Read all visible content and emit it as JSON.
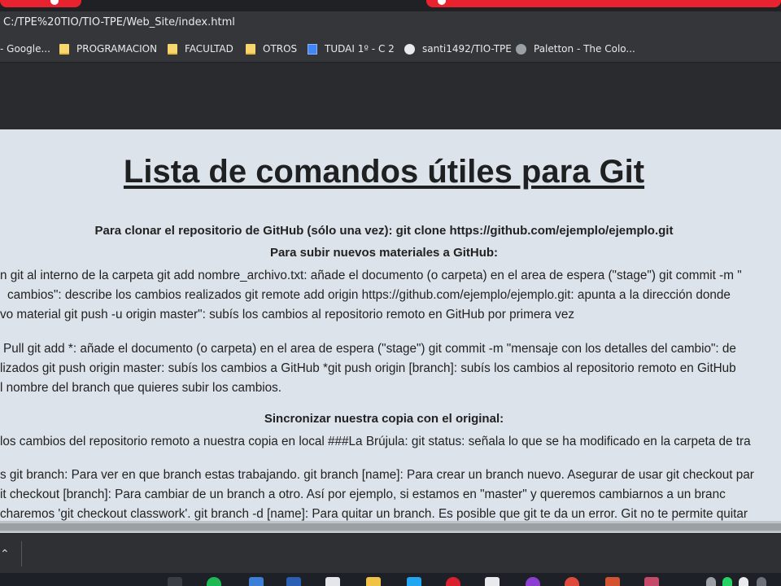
{
  "browser": {
    "url": "C:/TPE%20TIO/TIO-TPE/Web_Site/index.html",
    "bookmarks": [
      {
        "label": "- Google...",
        "icon": "none"
      },
      {
        "label": "PROGRAMACION",
        "icon": "folder-icon"
      },
      {
        "label": "FACULTAD",
        "icon": "folder-icon"
      },
      {
        "label": "OTROS",
        "icon": "folder-icon"
      },
      {
        "label": "TUDAI 1º - C 2",
        "icon": "google-docs-icon"
      },
      {
        "label": "santi1492/TIO-TPE",
        "icon": "github-icon"
      },
      {
        "label": "Paletton - The Colo...",
        "icon": "paletton-icon"
      }
    ]
  },
  "page": {
    "title": "Lista de comandos útiles para Git",
    "clone_line": "Para clonar el repositorio de GitHub (sólo una vez): git clone https://github.com/ejemplo/ejemplo.git",
    "upload_heading": "Para subir nuevos materiales a GitHub:",
    "paragraph1": [
      "n git al interno de la carpeta git add nombre_archivo.txt: añade el documento (o carpeta) en el area de espera (\"stage\") git commit -m \"",
      "cambios\": describe los cambios realizados git remote add origin https://github.com/ejemplo/ejemplo.git: apunta a la dirección donde",
      "vo material git push -u origin master\": subís los cambios al repositorio remoto en GitHub por primera vez"
    ],
    "paragraph2": [
      "Pull git add *: añade el documento (o carpeta) en el area de espera (\"stage\") git commit -m \"mensaje con los detalles del cambio\": de",
      "lizados git push origin master: subís los cambios a GitHub *git push origin [branch]: subís los cambios al repositorio remoto en GitHub",
      "l nombre del branch que quieres subir los cambios."
    ],
    "sync_heading": "Sincronizar nuestra copia con el original:",
    "paragraph3": [
      " los cambios del repositorio remoto a nuestra copia en local ###La Brújula: git status: señala lo que se ha modificado en la carpeta de tra"
    ],
    "paragraph4": [
      "s git branch: Para ver en que branch estas trabajando. git branch [name]: Para crear un branch nuevo. Asegurar de usar git checkout par",
      "it checkout [branch]: Para cambiar de un branch a otro. Así por ejemplo, si estamos en \"master\" y queremos cambiarnos a un branc",
      "charemos 'git checkout classwork'. git branch -d [name]: Para quitar un branch. Es posible que git te da un error. Git no te permite quitar"
    ]
  },
  "colors": {
    "page_background": "#dde3ea",
    "browser_chrome": "#35363a",
    "tab_accent": "#e8222e"
  }
}
